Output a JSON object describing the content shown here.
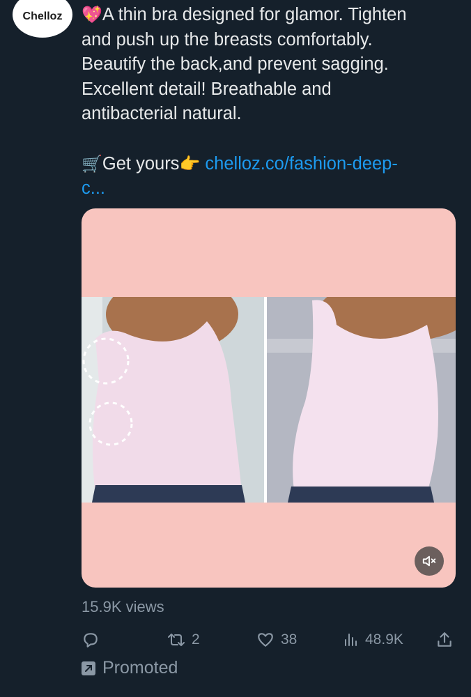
{
  "account": {
    "avatar_text": "Chelloz"
  },
  "tweet": {
    "lines": [
      "A thin bra designed for glamor. Tighten",
      "and push up the breasts comfortably.",
      "Beautify the back,and prevent sagging.",
      "Excellent detail! Breathable and",
      "antibacterial natural."
    ],
    "cta_text": "Get yours",
    "link_line1": "chelloz.co/fashion-deep-",
    "link_line2": "c..."
  },
  "media": {
    "muted": true
  },
  "stats": {
    "views": "15.9K views"
  },
  "actions": {
    "retweets": "2",
    "likes": "38",
    "analytics": "48.9K"
  },
  "promoted_label": "Promoted",
  "icons": [
    "sparkling-heart-icon",
    "shopping-cart-icon",
    "pointing-hand-icon",
    "mute-icon",
    "reply-icon",
    "retweet-icon",
    "like-icon",
    "analytics-icon",
    "share-icon",
    "promoted-icon"
  ],
  "colors": {
    "background": "#15202b",
    "link": "#1d9bf0",
    "muted_text": "#8b98a5",
    "media_bg": "#f8c5bf"
  }
}
